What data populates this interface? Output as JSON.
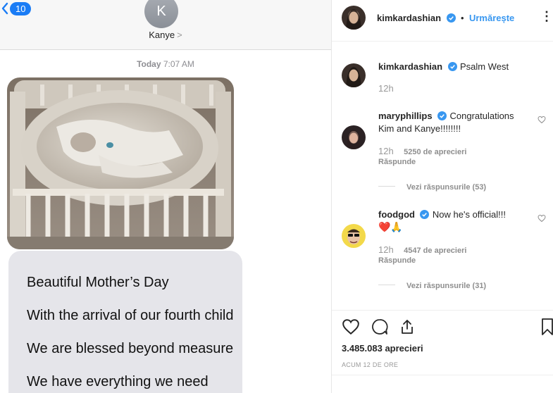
{
  "imessage": {
    "back_count": "10",
    "contact_initial": "K",
    "contact_name": "Kanye",
    "contact_chevron": ">",
    "timestamp_day": "Today",
    "timestamp_time": "7:07 AM",
    "message_lines": [
      "Beautiful Mother’s Day",
      "With the arrival of our fourth child",
      "We are blessed beyond measure",
      "We have everything we need"
    ]
  },
  "instagram": {
    "header": {
      "username": "kimkardashian",
      "separator": "•",
      "follow_label": "Urmărește",
      "more_label": "⋮"
    },
    "caption": {
      "username": "kimkardashian",
      "text": "Psalm West",
      "time": "12h"
    },
    "comments": [
      {
        "username": "maryphillips",
        "text_line1": "Congratulations",
        "text_line2": "Kim and Kanye!!!!!!!!",
        "time": "12h",
        "likes": "5250 de aprecieri",
        "reply": "Răspunde",
        "view_replies": "Vezi răspunsurile (53)"
      },
      {
        "username": "foodgod",
        "text_line1": "Now he's official!!!",
        "text_line2": "❤️🙏",
        "time": "12h",
        "likes": "4547 de aprecieri",
        "reply": "Răspunde",
        "view_replies": "Vezi răspunsurile (31)"
      }
    ],
    "likes_count": "3.485.083 aprecieri",
    "posted_ago": "ACUM 12 DE ORE"
  },
  "icons": [
    "back-chevron-icon",
    "verified-badge-icon",
    "more-options-icon",
    "heart-icon",
    "comment-icon",
    "share-icon",
    "bookmark-icon"
  ],
  "colors": {
    "imessage_blue": "#1a7cf5",
    "ig_link": "#3897f0",
    "verified": "#3897f0",
    "bubble_gray": "#e5e5ea"
  }
}
